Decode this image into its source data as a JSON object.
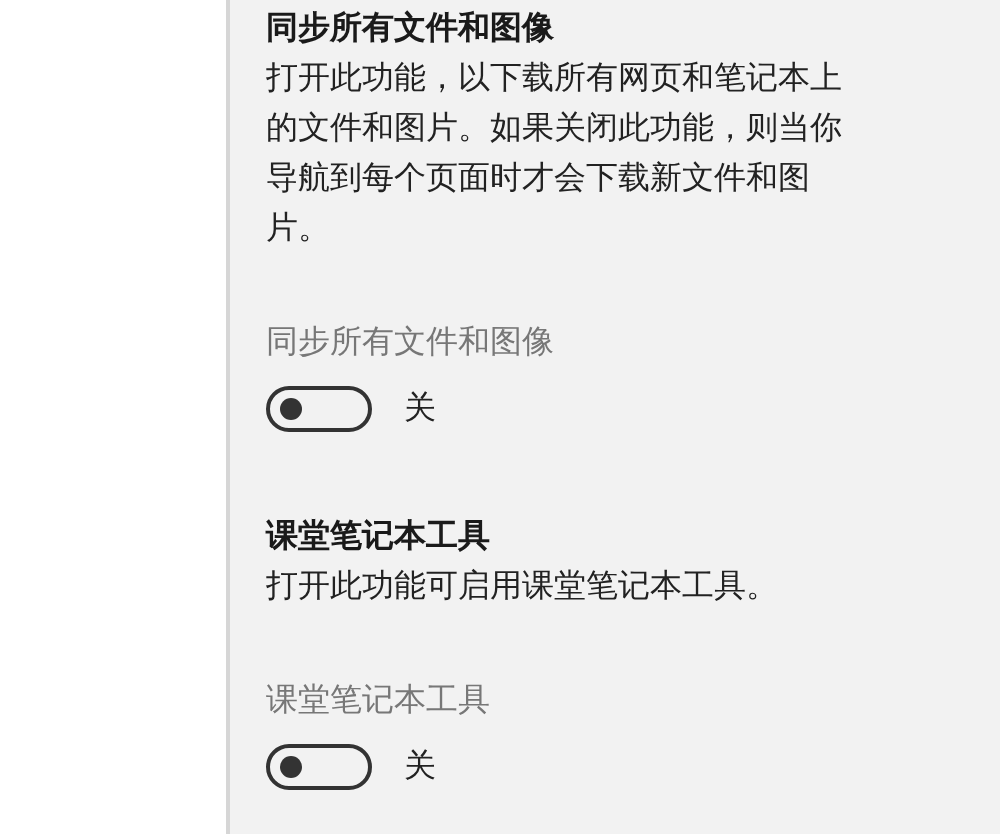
{
  "settings": [
    {
      "title": "同步所有文件和图像",
      "description": "打开此功能，以下载所有网页和笔记本上的文件和图片。如果关闭此功能，则当你导航到每个页面时才会下载新文件和图片。",
      "toggle_label": "同步所有文件和图像",
      "on": false,
      "state_text": "关"
    },
    {
      "title": "课堂笔记本工具",
      "description": "打开此功能可启用课堂笔记本工具。",
      "toggle_label": "课堂笔记本工具",
      "on": false,
      "state_text": "关"
    }
  ]
}
